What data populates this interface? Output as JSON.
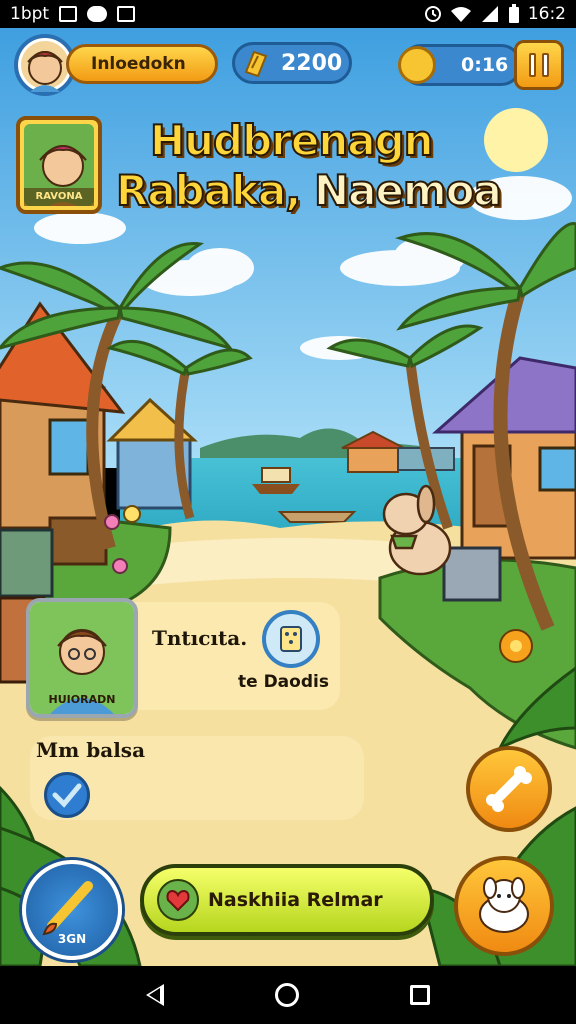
{
  "status_bar": {
    "left_text": "1bpt",
    "time": "16:2"
  },
  "hud": {
    "player_name": "Inloedokn",
    "coins": "2200",
    "timer": "0:16"
  },
  "character_card": {
    "label": "RAVONA"
  },
  "title": {
    "line1": "Hudbrenagn",
    "line2_a": "Rabaka,",
    "line2_b": "Naemoa"
  },
  "dialog": {
    "portrait_label": "HUIORADN",
    "text1": "Tntıcıta.",
    "text2": "te Daodis"
  },
  "panel2": {
    "text": "Mm balsa"
  },
  "buttons": {
    "paint_label": "3GN",
    "main_label": "Naskhiia Relmar"
  },
  "colors": {
    "sky": "#5bb8ec",
    "sea": "#2bb5c9",
    "sand": "#f6e2a4",
    "accent_yellow": "#ffd64a",
    "accent_blue": "#3b88cf",
    "grass": "#5aa83c"
  },
  "icons": {
    "coin": "coin-icon",
    "timer": "clock-icon",
    "pause": "pause-icon",
    "bone": "bone-icon",
    "pet": "dog-icon",
    "paint": "paintbrush-icon",
    "heart": "heart-icon",
    "check": "checkmark-icon"
  }
}
